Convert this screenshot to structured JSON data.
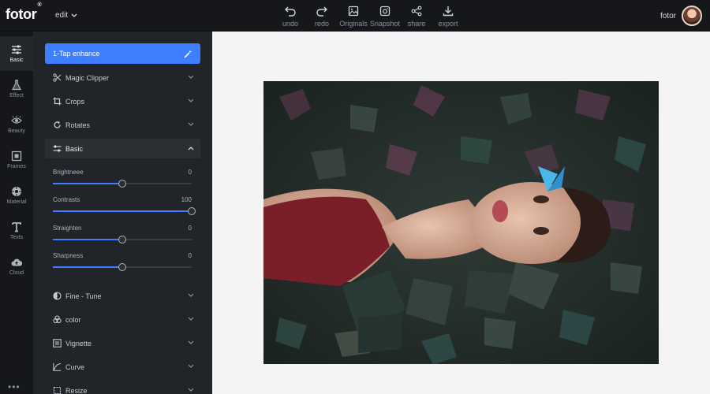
{
  "app": {
    "logo": "fotor",
    "logo_mark": "®"
  },
  "header": {
    "menu_label": "edit",
    "tools": [
      {
        "label": "undo",
        "icon": "undo-icon"
      },
      {
        "label": "redo",
        "icon": "redo-icon"
      },
      {
        "label": "Originals",
        "icon": "image-icon"
      },
      {
        "label": "Snapshot",
        "icon": "snapshot-icon"
      },
      {
        "label": "share",
        "icon": "share-icon"
      },
      {
        "label": "export",
        "icon": "download-icon"
      }
    ],
    "user_name": "fotor"
  },
  "rail": {
    "items": [
      {
        "label": "Basic",
        "icon": "sliders-icon",
        "active": true
      },
      {
        "label": "Effect",
        "icon": "flask-icon"
      },
      {
        "label": "Beauty",
        "icon": "eye-icon"
      },
      {
        "label": "Frames",
        "icon": "frame-icon"
      },
      {
        "label": "Material",
        "icon": "material-icon"
      },
      {
        "label": "Texts",
        "icon": "text-icon"
      },
      {
        "label": "Cloud",
        "icon": "cloud-upload-icon"
      }
    ],
    "more": "•••"
  },
  "panel": {
    "enhance_label": "1-Tap enhance",
    "sections_top": [
      {
        "label": "Magic Clipper",
        "icon": "scissors-icon"
      },
      {
        "label": "Crops",
        "icon": "crop-icon"
      },
      {
        "label": "Rotates",
        "icon": "rotate-icon"
      }
    ],
    "basic_section": {
      "label": "Basic",
      "icon": "sliders-icon",
      "expanded": true
    },
    "sliders": [
      {
        "label": "Brightneee",
        "value": "0",
        "percent": 50
      },
      {
        "label": "Contrasts",
        "value": "100",
        "percent": 100
      },
      {
        "label": "Straighten",
        "value": "0",
        "percent": 50
      },
      {
        "label": "Sharpness",
        "value": "0",
        "percent": 50
      }
    ],
    "sections_bottom": [
      {
        "label": "Fine - Tune",
        "icon": "half-circle-icon"
      },
      {
        "label": "color",
        "icon": "color-circles-icon"
      },
      {
        "label": "Vignette",
        "icon": "vignette-icon"
      },
      {
        "label": "Curve",
        "icon": "curve-icon"
      },
      {
        "label": "Resize",
        "icon": "resize-icon"
      }
    ]
  },
  "colors": {
    "accent": "#3d7fff",
    "topbar": "#15171a",
    "panel": "#212428",
    "canvas": "#f4f4f4"
  }
}
